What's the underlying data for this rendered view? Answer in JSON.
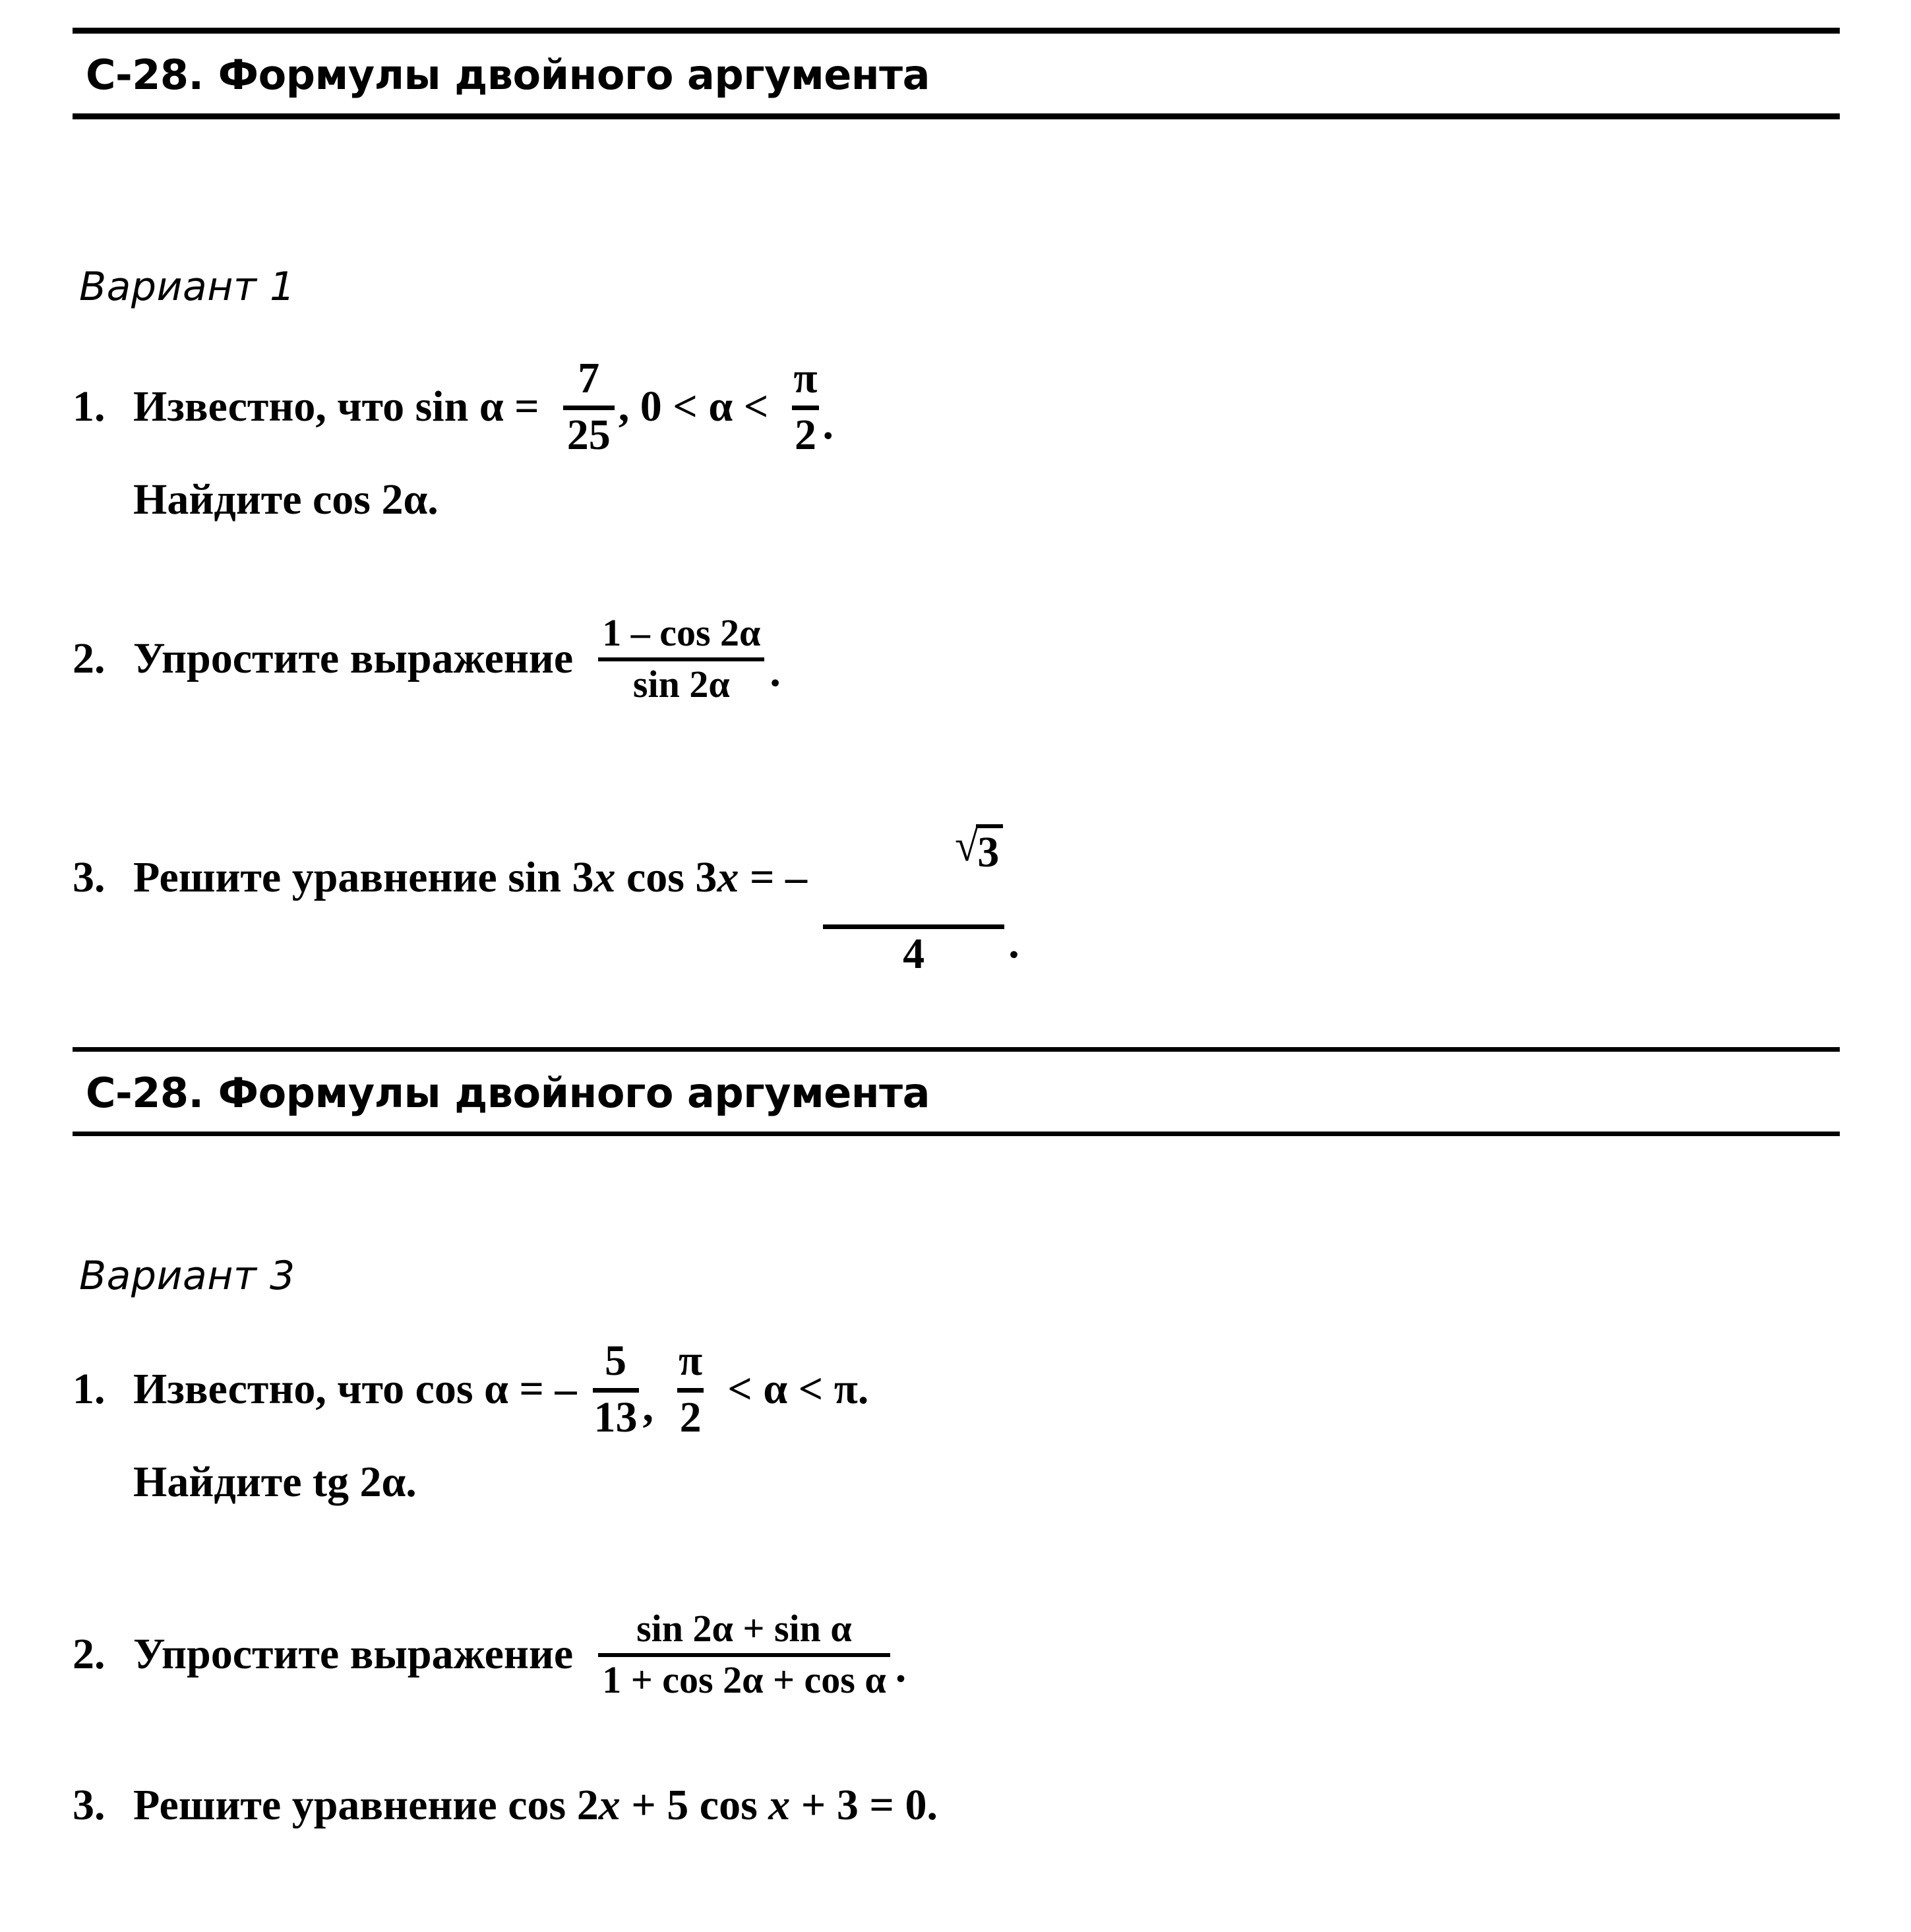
{
  "document": {
    "type": "math-worksheet",
    "language": "ru"
  },
  "sections": [
    {
      "header": {
        "code": "С-28.",
        "title": "Формулы двойного аргумента"
      },
      "variant_label": "Вариант 1",
      "problems": [
        {
          "number": "1.",
          "line1_before": "Известно, что sin α =",
          "fraction": {
            "numerator": "7",
            "denominator": "25"
          },
          "line1_after": ", 0 < α <",
          "fraction2": {
            "numerator": "π",
            "denominator": "2"
          },
          "line1_end": ".",
          "line2": "Найдите cos 2α."
        },
        {
          "number": "2.",
          "text": "Упростите выражение",
          "fraction": {
            "numerator": "1 – cos 2α",
            "denominator": "sin 2α"
          },
          "end": "."
        },
        {
          "number": "3.",
          "text": "Решите уравнение sin 3x cos 3x = –",
          "text_plain": "Решите уравнение sin 3",
          "radical_fraction": {
            "numerator": "3",
            "denominator": "4",
            "radical": "√"
          },
          "end": "."
        }
      ]
    },
    {
      "header": {
        "code": "С-28.",
        "title": "Формулы двойного аргумента"
      },
      "variant_label": "Вариант 3",
      "problems": [
        {
          "number": "1.",
          "line1_before": "Известно, что cos α = –",
          "fraction": {
            "numerator": "5",
            "denominator": "13"
          },
          "line1_after": ",",
          "fraction2": {
            "numerator": "π",
            "denominator": "2"
          },
          "line1_end": "< α < π.",
          "line2": "Найдите tg 2α."
        },
        {
          "number": "2.",
          "text": "Упростите выражение",
          "fraction": {
            "numerator": "sin 2α + sin α",
            "denominator": "1 + cos 2α + cos α"
          },
          "end": "."
        },
        {
          "number": "3.",
          "text_full": "Решите уравнение cos 2x + 5 cos x + 3 = 0."
        }
      ]
    }
  ],
  "tokens": {
    "izvestno_sin": "Известно, что sin α =",
    "izvestno_cos": "Известно, что cos α = –",
    "comma": ",",
    "zero_lt_alpha_lt": ", 0 < α <",
    "lt_alpha_lt_pi": "< α < π.",
    "period": ".",
    "naydite_cos2a": "Найдите cos 2α.",
    "naydite_tg2a": "Найдите tg 2α.",
    "uprostite": "Упростите выражение",
    "reshite_sin3x": "Решите уравнение sin 3x cos 3x = –",
    "reshite_cos2x": "Решите уравнение cos 2x + 5 cos x + 3 = 0."
  },
  "colors": {
    "ink": "#000000",
    "paper": "#ffffff"
  }
}
